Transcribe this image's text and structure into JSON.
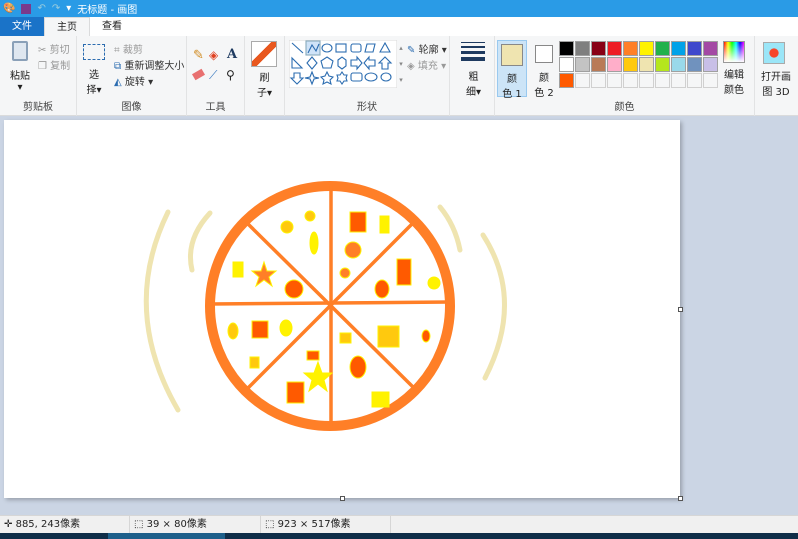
{
  "title": "无标题 - 画图",
  "tabs": [
    "文件",
    "主页",
    "查看"
  ],
  "clipboard": {
    "paste": "粘贴",
    "cut": "剪切",
    "copy": "复制",
    "label": "剪贴板"
  },
  "image": {
    "select1": "选",
    "select2": "择",
    "crop": "裁剪",
    "resize": "重新调整大小",
    "rotate": "旋转",
    "label": "图像"
  },
  "tools": {
    "label": "工具"
  },
  "brush": {
    "l1": "刷",
    "l2": "子"
  },
  "shapes": {
    "outline": "轮廓",
    "fill": "填充",
    "label": "形状"
  },
  "size": {
    "l1": "粗",
    "l2": "细"
  },
  "colors": {
    "c1a": "颜",
    "c1b": "色 1",
    "c2a": "颜",
    "c2b": "色 2",
    "edit1": "编辑",
    "edit2": "颜色",
    "label": "颜色",
    "color1": "#efe4b0",
    "color2": "#ffffff",
    "palette": [
      "#000000",
      "#7f7f7f",
      "#880015",
      "#ed1c24",
      "#ff7f27",
      "#fff200",
      "#22b14c",
      "#00a2e8",
      "#3f48cc",
      "#a349a4",
      "#ffffff",
      "#c3c3c3",
      "#b97a57",
      "#ffaec9",
      "#ffc90e",
      "#efe4b0",
      "#b5e61d",
      "#99d9ea",
      "#7092be",
      "#c8bfe7",
      "#ff5a00",
      "#f5f6f7",
      "#f5f6f7",
      "#f5f6f7",
      "#f5f6f7",
      "#f5f6f7",
      "#f5f6f7",
      "#f5f6f7",
      "#f5f6f7",
      "#f5f6f7"
    ]
  },
  "paint3d": {
    "l1": "打开画",
    "l2": "图 3D"
  },
  "status": {
    "cursor": "885, 243像素",
    "selection": "39 × 80像素",
    "canvas_size": "923 × 517像素"
  }
}
